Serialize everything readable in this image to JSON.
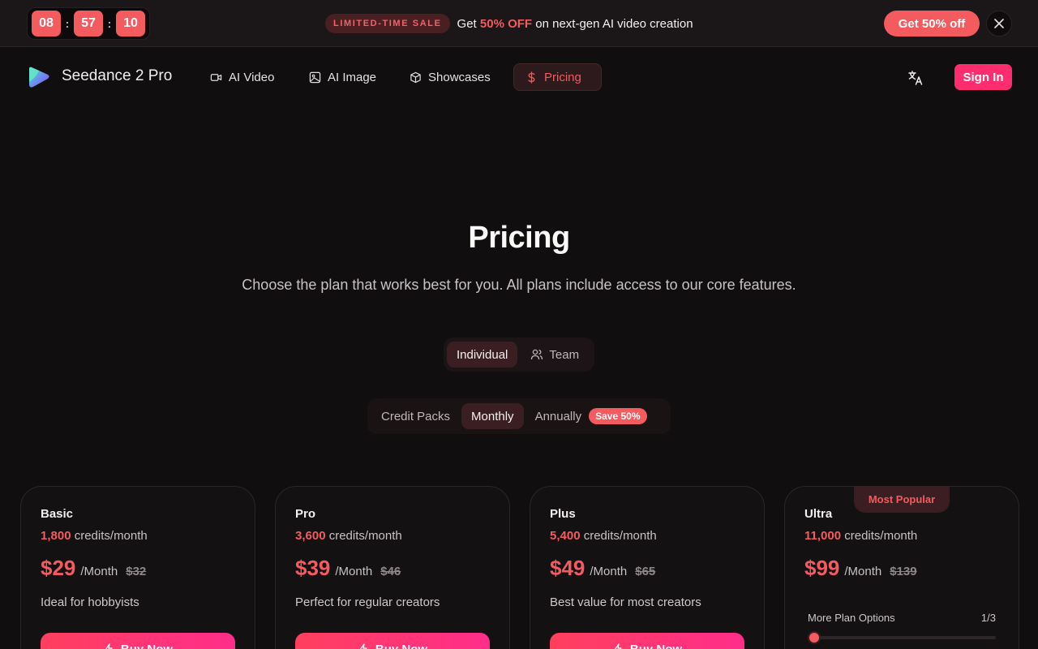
{
  "promo": {
    "timer": {
      "hours": "08",
      "minutes": "57",
      "seconds": "10",
      "sep": ":"
    },
    "tag": "LIMITED-TIME SALE",
    "text_before": "Get",
    "highlight": "50% OFF",
    "text_after": "on next-gen AI video creation",
    "cta": "Get 50% off"
  },
  "nav": {
    "brand": "Seedance 2 Pro",
    "items": [
      {
        "label": "AI Video",
        "icon": "video-icon"
      },
      {
        "label": "AI Image",
        "icon": "image-icon"
      },
      {
        "label": "Showcases",
        "icon": "box-icon"
      },
      {
        "label": "Pricing",
        "icon": "dollar-icon",
        "active": true
      }
    ],
    "sign_in": "Sign In"
  },
  "hero": {
    "title": "Pricing",
    "subtitle": "Choose the plan that works best for you. All plans include access to our core features."
  },
  "audience_toggle": {
    "individual": "Individual",
    "team": "Team",
    "selected": "Individual"
  },
  "billing_toggle": {
    "credit_packs": "Credit Packs",
    "monthly": "Monthly",
    "annually": "Annually",
    "save_badge": "Save 50%",
    "selected": "Monthly"
  },
  "plans": [
    {
      "name": "Basic",
      "credits": "1,800",
      "credits_unit": "credits/month",
      "price": "$29",
      "period": "/Month",
      "old_price": "$32",
      "description": "Ideal for hobbyists",
      "cta": "Buy Now"
    },
    {
      "name": "Pro",
      "credits": "3,600",
      "credits_unit": "credits/month",
      "price": "$39",
      "period": "/Month",
      "old_price": "$46",
      "description": "Perfect for regular creators",
      "cta": "Buy Now"
    },
    {
      "name": "Plus",
      "credits": "5,400",
      "credits_unit": "credits/month",
      "price": "$49",
      "period": "/Month",
      "old_price": "$65",
      "description": "Best value for most creators",
      "cta": "Buy Now"
    },
    {
      "name": "Ultra",
      "badge": "Most Popular",
      "credits": "11,000",
      "credits_unit": "credits/month",
      "price": "$99",
      "period": "/Month",
      "old_price": "$139",
      "more_options_label": "More Plan Options",
      "more_options_page": "1/3",
      "slider_fraction": 0
    }
  ],
  "colors": {
    "accent": "#f45b5f",
    "signin": "#ff2d6f",
    "background": "#110e0f"
  }
}
